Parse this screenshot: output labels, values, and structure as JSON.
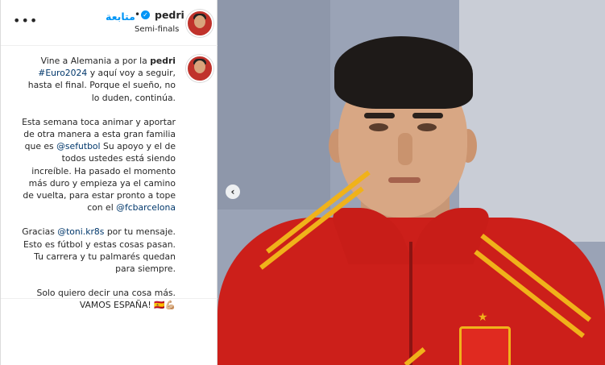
{
  "header": {
    "more_label": "•••",
    "follow_label": "متابعة",
    "separator": "•",
    "verified_icon": "verified-badge-icon",
    "username": "pedri",
    "subtitle": "Semi-finals"
  },
  "caption": {
    "username": "pedri",
    "p1_prefix": "Vine a Alemania a por la",
    "p1_hashtag": "#Euro2024",
    "p1_suffix": "y aquí voy a seguir, hasta el final. Porque el sueño, no lo duden, continúa.",
    "p2_prefix": "Esta semana toca animar y aportar de otra manera a esta gran familia que es",
    "p2_mention1": "@sefutbol",
    "p2_middle": "Su apoyo y el de todos ustedes está siendo increíble. Ha pasado el momento más duro y empieza ya el camino de vuelta, para estar pronto a tope con el",
    "p2_mention2": "@fcbarcelona",
    "p3_prefix": "Gracias",
    "p3_mention": "@toni.kr8s",
    "p3_suffix": "por tu mensaje. Esto es fútbol y estas cosas pasan. Tu carrera y tu palmarés quedan para siempre.",
    "p4_line1": "Solo quiero decir una cosa más.",
    "p4_line2": "VAMOS ESPAÑA! 🇪🇸💪🏼"
  },
  "carousel": {
    "prev_label": "‹"
  },
  "colors": {
    "link": "#00376b",
    "follow": "#0095f6",
    "jersey": "#cc1f1a",
    "stripe": "#f0b21a"
  }
}
